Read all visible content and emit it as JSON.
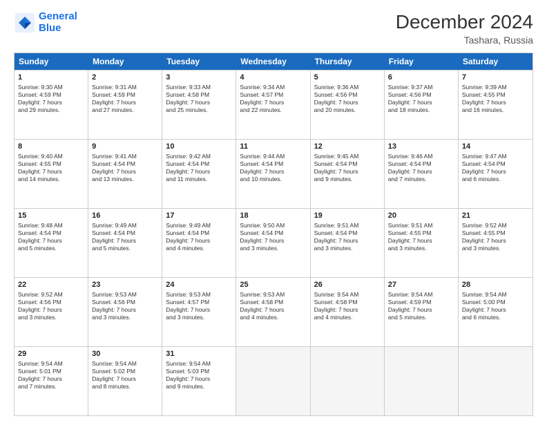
{
  "logo": {
    "line1": "General",
    "line2": "Blue"
  },
  "title": "December 2024",
  "subtitle": "Tashara, Russia",
  "days": [
    "Sunday",
    "Monday",
    "Tuesday",
    "Wednesday",
    "Thursday",
    "Friday",
    "Saturday"
  ],
  "rows": [
    [
      {
        "day": "1",
        "info": "Sunrise: 9:30 AM\nSunset: 4:59 PM\nDaylight: 7 hours\nand 29 minutes."
      },
      {
        "day": "2",
        "info": "Sunrise: 9:31 AM\nSunset: 4:59 PM\nDaylight: 7 hours\nand 27 minutes."
      },
      {
        "day": "3",
        "info": "Sunrise: 9:33 AM\nSunset: 4:58 PM\nDaylight: 7 hours\nand 25 minutes."
      },
      {
        "day": "4",
        "info": "Sunrise: 9:34 AM\nSunset: 4:57 PM\nDaylight: 7 hours\nand 22 minutes."
      },
      {
        "day": "5",
        "info": "Sunrise: 9:36 AM\nSunset: 4:56 PM\nDaylight: 7 hours\nand 20 minutes."
      },
      {
        "day": "6",
        "info": "Sunrise: 9:37 AM\nSunset: 4:56 PM\nDaylight: 7 hours\nand 18 minutes."
      },
      {
        "day": "7",
        "info": "Sunrise: 9:39 AM\nSunset: 4:55 PM\nDaylight: 7 hours\nand 16 minutes."
      }
    ],
    [
      {
        "day": "8",
        "info": "Sunrise: 9:40 AM\nSunset: 4:55 PM\nDaylight: 7 hours\nand 14 minutes."
      },
      {
        "day": "9",
        "info": "Sunrise: 9:41 AM\nSunset: 4:54 PM\nDaylight: 7 hours\nand 13 minutes."
      },
      {
        "day": "10",
        "info": "Sunrise: 9:42 AM\nSunset: 4:54 PM\nDaylight: 7 hours\nand 11 minutes."
      },
      {
        "day": "11",
        "info": "Sunrise: 9:44 AM\nSunset: 4:54 PM\nDaylight: 7 hours\nand 10 minutes."
      },
      {
        "day": "12",
        "info": "Sunrise: 9:45 AM\nSunset: 4:54 PM\nDaylight: 7 hours\nand 9 minutes."
      },
      {
        "day": "13",
        "info": "Sunrise: 9:46 AM\nSunset: 4:54 PM\nDaylight: 7 hours\nand 7 minutes."
      },
      {
        "day": "14",
        "info": "Sunrise: 9:47 AM\nSunset: 4:54 PM\nDaylight: 7 hours\nand 6 minutes."
      }
    ],
    [
      {
        "day": "15",
        "info": "Sunrise: 9:48 AM\nSunset: 4:54 PM\nDaylight: 7 hours\nand 5 minutes."
      },
      {
        "day": "16",
        "info": "Sunrise: 9:49 AM\nSunset: 4:54 PM\nDaylight: 7 hours\nand 5 minutes."
      },
      {
        "day": "17",
        "info": "Sunrise: 9:49 AM\nSunset: 4:54 PM\nDaylight: 7 hours\nand 4 minutes."
      },
      {
        "day": "18",
        "info": "Sunrise: 9:50 AM\nSunset: 4:54 PM\nDaylight: 7 hours\nand 3 minutes."
      },
      {
        "day": "19",
        "info": "Sunrise: 9:51 AM\nSunset: 4:54 PM\nDaylight: 7 hours\nand 3 minutes."
      },
      {
        "day": "20",
        "info": "Sunrise: 9:51 AM\nSunset: 4:55 PM\nDaylight: 7 hours\nand 3 minutes."
      },
      {
        "day": "21",
        "info": "Sunrise: 9:52 AM\nSunset: 4:55 PM\nDaylight: 7 hours\nand 3 minutes."
      }
    ],
    [
      {
        "day": "22",
        "info": "Sunrise: 9:52 AM\nSunset: 4:56 PM\nDaylight: 7 hours\nand 3 minutes."
      },
      {
        "day": "23",
        "info": "Sunrise: 9:53 AM\nSunset: 4:56 PM\nDaylight: 7 hours\nand 3 minutes."
      },
      {
        "day": "24",
        "info": "Sunrise: 9:53 AM\nSunset: 4:57 PM\nDaylight: 7 hours\nand 3 minutes."
      },
      {
        "day": "25",
        "info": "Sunrise: 9:53 AM\nSunset: 4:58 PM\nDaylight: 7 hours\nand 4 minutes."
      },
      {
        "day": "26",
        "info": "Sunrise: 9:54 AM\nSunset: 4:58 PM\nDaylight: 7 hours\nand 4 minutes."
      },
      {
        "day": "27",
        "info": "Sunrise: 9:54 AM\nSunset: 4:59 PM\nDaylight: 7 hours\nand 5 minutes."
      },
      {
        "day": "28",
        "info": "Sunrise: 9:54 AM\nSunset: 5:00 PM\nDaylight: 7 hours\nand 6 minutes."
      }
    ],
    [
      {
        "day": "29",
        "info": "Sunrise: 9:54 AM\nSunset: 5:01 PM\nDaylight: 7 hours\nand 7 minutes."
      },
      {
        "day": "30",
        "info": "Sunrise: 9:54 AM\nSunset: 5:02 PM\nDaylight: 7 hours\nand 8 minutes."
      },
      {
        "day": "31",
        "info": "Sunrise: 9:54 AM\nSunset: 5:03 PM\nDaylight: 7 hours\nand 9 minutes."
      },
      {
        "day": "",
        "info": ""
      },
      {
        "day": "",
        "info": ""
      },
      {
        "day": "",
        "info": ""
      },
      {
        "day": "",
        "info": ""
      }
    ]
  ]
}
